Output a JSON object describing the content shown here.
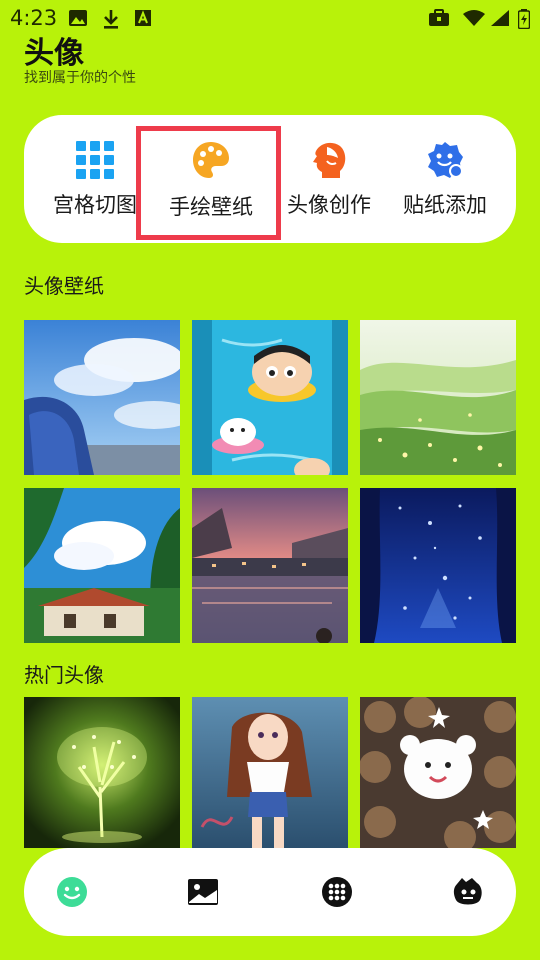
{
  "status_bar": {
    "time": "4:23",
    "left_icons": [
      "image-icon",
      "download-icon",
      "a-icon"
    ],
    "right_icons": [
      "briefcase-icon",
      "wifi-icon",
      "signal-icon",
      "battery-icon"
    ]
  },
  "header": {
    "title": "头像",
    "subtitle": "找到属于你的个性"
  },
  "tools": [
    {
      "label": "宫格切图",
      "icon": "grid-icon",
      "color": "#1BA3F2"
    },
    {
      "label": "手绘壁纸",
      "icon": "palette-icon",
      "color": "#F6A623",
      "highlighted": true
    },
    {
      "label": "头像创作",
      "icon": "face-profile-icon",
      "color": "#F4621F"
    },
    {
      "label": "贴纸添加",
      "icon": "sticker-icon",
      "color": "#2F6FE8"
    }
  ],
  "sections": {
    "wallpapers_title": "头像壁纸",
    "wallpapers": [
      "anime-girl-sky",
      "crayon-shin-chan-pool",
      "green-hills-meadow",
      "summer-house-clouds",
      "sunset-lake-village",
      "starry-night-curtain"
    ],
    "hot_title": "热门头像",
    "hot_avatars": [
      "glowing-tree",
      "anime-girl-underwater",
      "white-dog-crowd"
    ]
  },
  "bottom_nav": [
    {
      "icon": "smile-icon",
      "active": true
    },
    {
      "icon": "gallery-icon",
      "active": false
    },
    {
      "icon": "apps-grid-icon",
      "active": false
    },
    {
      "icon": "monster-icon",
      "active": false
    }
  ],
  "colors": {
    "background": "#B8F20A",
    "card": "#FFFFFF",
    "highlight": "#EE3B4B",
    "nav_active": "#3DDC97"
  }
}
